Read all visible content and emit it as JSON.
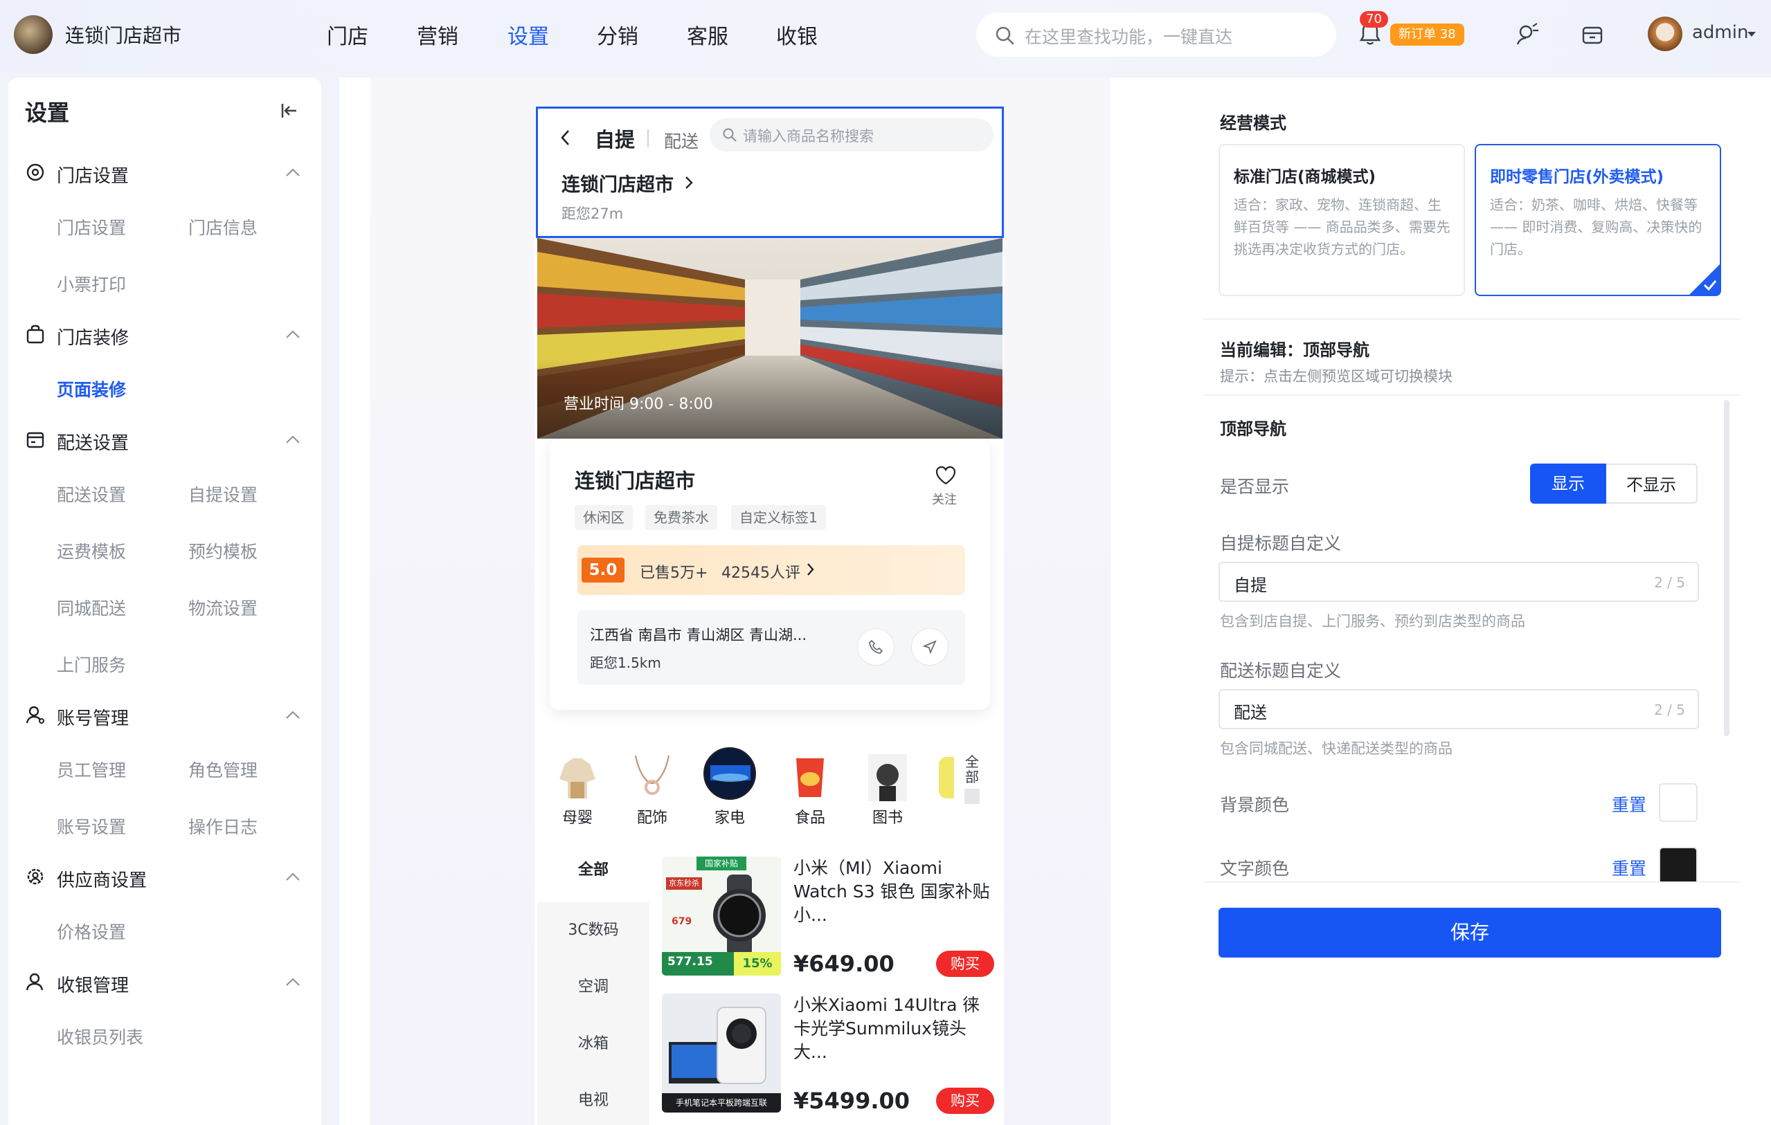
{
  "app": {
    "title": "连锁门店超市"
  },
  "nav": [
    "门店",
    "营销",
    "设置",
    "分销",
    "客服",
    "收银"
  ],
  "search": {
    "placeholder": "在这里查找功能，一键直达"
  },
  "notifications": {
    "count": "70",
    "new_orders": "新订单 38"
  },
  "user": {
    "name": "admin"
  },
  "sidebar": {
    "title": "设置",
    "groups": [
      {
        "label": "门店设置",
        "items": [
          "门店设置",
          "门店信息",
          "小票打印"
        ]
      },
      {
        "label": "门店装修",
        "items": [
          "页面装修"
        ]
      },
      {
        "label": "配送设置",
        "items": [
          "配送设置",
          "自提设置",
          "运费模板",
          "预约模板",
          "同城配送",
          "物流设置",
          "上门服务"
        ]
      },
      {
        "label": "账号管理",
        "items": [
          "员工管理",
          "角色管理",
          "账号设置",
          "操作日志"
        ]
      },
      {
        "label": "供应商设置",
        "items": [
          "价格设置"
        ]
      },
      {
        "label": "收银管理",
        "items": [
          "收银员列表"
        ]
      }
    ]
  },
  "preview": {
    "tab_pickup": "自提",
    "tab_delivery": "配送",
    "search_placeholder": "请输入商品名称搜索",
    "store_name": "连锁门店超市",
    "distance": "距您27m",
    "hours": "营业时间 9:00 - 8:00",
    "card": {
      "name": "连锁门店超市",
      "follow": "关注",
      "tags": [
        "休闲区",
        "免费茶水",
        "自定义标签1"
      ],
      "score": "5.0",
      "sold": "已售5万+",
      "reviews": "42545人评",
      "address": "江西省 南昌市 青山湖区 青山湖...",
      "addr_distance": "距您1.5km"
    },
    "categories": [
      "母婴",
      "配饰",
      "家电",
      "食品",
      "图书"
    ],
    "categories_all": "全部",
    "left_menu": [
      "全部",
      "3C数码",
      "空调",
      "冰箱",
      "电视"
    ],
    "products": [
      {
        "name": "小米（MI）Xiaomi Watch S3 银色 国家补贴 小...",
        "price": "¥649.00",
        "buy": "购买",
        "promo_top": "国家补贴",
        "promo_shop": "京东秒杀",
        "promo_price": "679",
        "promo_final": "577.15",
        "promo_rate": "15%"
      },
      {
        "name": "小米Xiaomi 14Ultra 徕卡光学Summilux镜头 大...",
        "price": "¥5499.00",
        "buy": "购买",
        "promo_bottom": "手机笔记本平板跨端互联"
      }
    ]
  },
  "panel": {
    "mode_title": "经营模式",
    "modes": [
      {
        "title": "标准门店(商城模式)",
        "desc": "适合：家政、宠物、连锁商超、生鲜百货等 —— 商品品类多、需要先挑选再决定收货方式的门店。"
      },
      {
        "title": "即时零售门店(外卖模式)",
        "desc": "适合：奶茶、咖啡、烘焙、快餐等 —— 即时消费、复购高、决策快的门店。"
      }
    ],
    "editing": "当前编辑：顶部导航",
    "editing_hint": "提示：点击左侧预览区域可切换模块",
    "section": "顶部导航",
    "show_label": "是否显示",
    "show_on": "显示",
    "show_off": "不显示",
    "pickup_label": "自提标题自定义",
    "pickup_value": "自提",
    "pickup_count": "2 / 5",
    "pickup_hint": "包含到店自提、上门服务、预约到店类型的商品",
    "delivery_label": "配送标题自定义",
    "delivery_value": "配送",
    "delivery_count": "2 / 5",
    "delivery_hint": "包含同城配送、快递配送类型的商品",
    "bg_label": "背景颜色",
    "text_label": "文字颜色",
    "reset": "重置",
    "bg_color": "#ffffff",
    "text_color": "#1a1a1a",
    "save": "保存"
  },
  "colors": {
    "accent": "#1f5cf0",
    "badge": "#f13a2f",
    "order": "#ff9a1a",
    "buy": "#f02a2a"
  }
}
